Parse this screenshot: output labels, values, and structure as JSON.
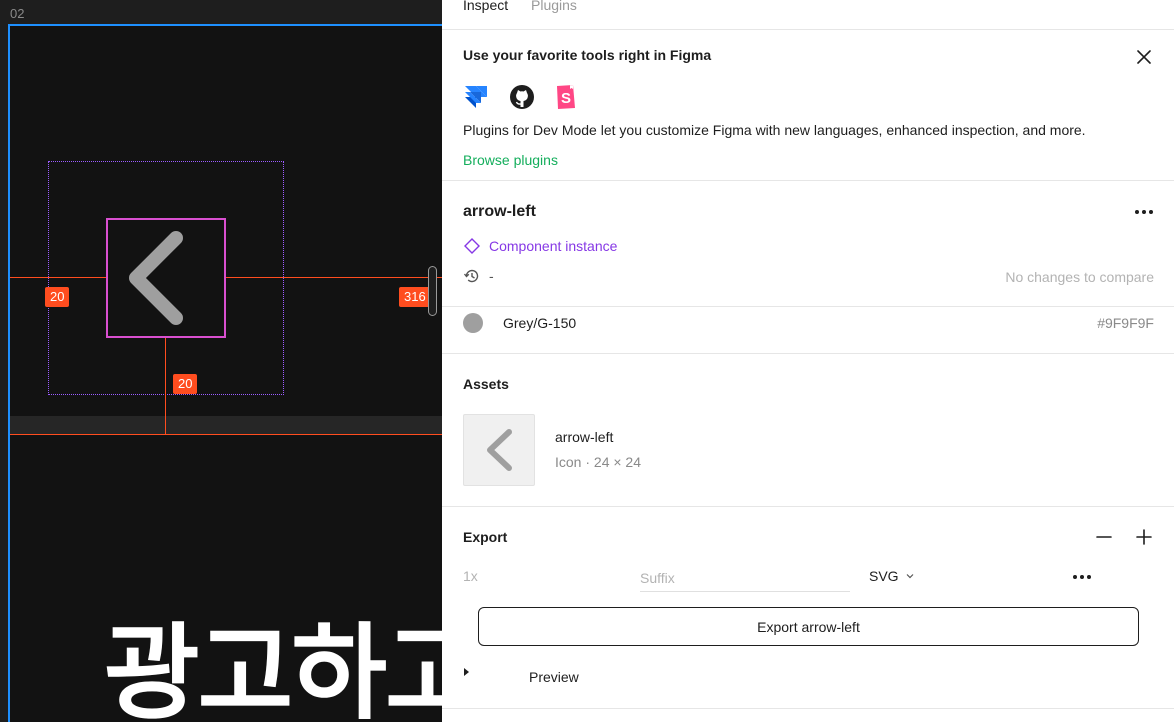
{
  "canvas": {
    "frame_label": "02",
    "badges": {
      "left": "20",
      "right": "316",
      "bottom": "20"
    },
    "big_text": "광고하고"
  },
  "tabs": {
    "inspect": "Inspect",
    "plugins": "Plugins"
  },
  "promo": {
    "title": "Use your favorite tools right in Figma",
    "description": "Plugins for Dev Mode let you customize Figma with new languages, enhanced inspection, and more.",
    "link": "Browse plugins",
    "icons": [
      "jira-icon",
      "github-icon",
      "storybook-icon"
    ]
  },
  "component": {
    "name": "arrow-left",
    "type": "Component instance",
    "history_value": "-",
    "no_changes": "No changes to compare"
  },
  "color": {
    "name": "Grey/G-150",
    "hex": "#9F9F9F"
  },
  "assets": {
    "title": "Assets",
    "item": {
      "name": "arrow-left",
      "meta": "Icon · 24 × 24"
    }
  },
  "export": {
    "title": "Export",
    "scale": "1x",
    "suffix_placeholder": "Suffix",
    "format": "SVG",
    "button_label": "Export arrow-left",
    "preview_label": "Preview"
  },
  "colors": {
    "canvas_bg": "#121212",
    "measure": "#ff4d1f",
    "selection": "#d94fd0",
    "frame_border": "#1e90ff",
    "link_green": "#14ae5c",
    "component_purple": "#8638e5"
  }
}
